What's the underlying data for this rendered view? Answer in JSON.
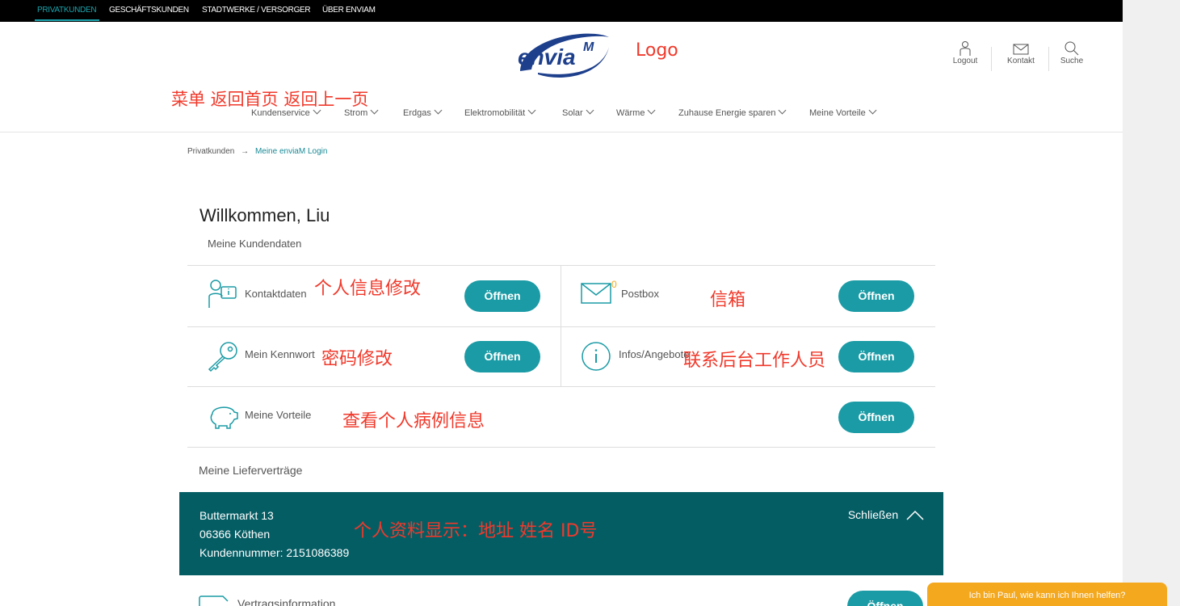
{
  "topnav": {
    "items": [
      "PRIVATKUNDEN",
      "GESCHÄFTSKUNDEN",
      "STADTWERKE / VERSORGER",
      "ÜBER ENVIAM"
    ]
  },
  "logo": {
    "text": "envia",
    "sup": "M"
  },
  "header_icons": {
    "logout": "Logout",
    "kontakt": "Kontakt",
    "suche": "Suche"
  },
  "mainnav": {
    "items": [
      "Kundenservice",
      "Strom",
      "Erdgas",
      "Elektromobilität",
      "Solar",
      "Wärme",
      "Zuhause Energie sparen",
      "Meine Vorteile"
    ]
  },
  "breadcrumb": {
    "home": "Privatkunden",
    "arrow": "→",
    "current": "Meine enviaM Login"
  },
  "welcome": "Willkommen, Liu",
  "subhead": "Meine Kundendaten",
  "cards": {
    "kontaktdaten": "Kontaktdaten",
    "postbox": "Postbox",
    "postbox_count": "0",
    "kennwort": "Mein Kennwort",
    "infos": "Infos/Angebote",
    "vorteile": "Meine Vorteile",
    "button": "Öffnen"
  },
  "annotations": {
    "logo": "Logo",
    "menu": "菜单 返回首页 返回上一页",
    "kontakt": "个人信息修改",
    "postbox": "信箱",
    "kennwort": "密码修改",
    "infos": "联系后台工作人员",
    "vorteile": "查看个人病例信息",
    "panel": "个人资料显示：地址 姓名 ID号"
  },
  "liefer": "Meine Lieferverträge",
  "panel": {
    "street": "Buttermarkt 13",
    "city": "06366 Köthen",
    "kundennummer": "Kundennummer: 2151086389",
    "close": "Schließen"
  },
  "vertrag": "Vertragsinformation",
  "vertrag_button": "Öffnen",
  "chat": "Ich bin Paul, wie kann ich Ihnen helfen?",
  "colors": {
    "accent": "#1a9ba5",
    "panel": "#055d64",
    "annotation": "#f0392b",
    "chat": "#f4a81e"
  }
}
